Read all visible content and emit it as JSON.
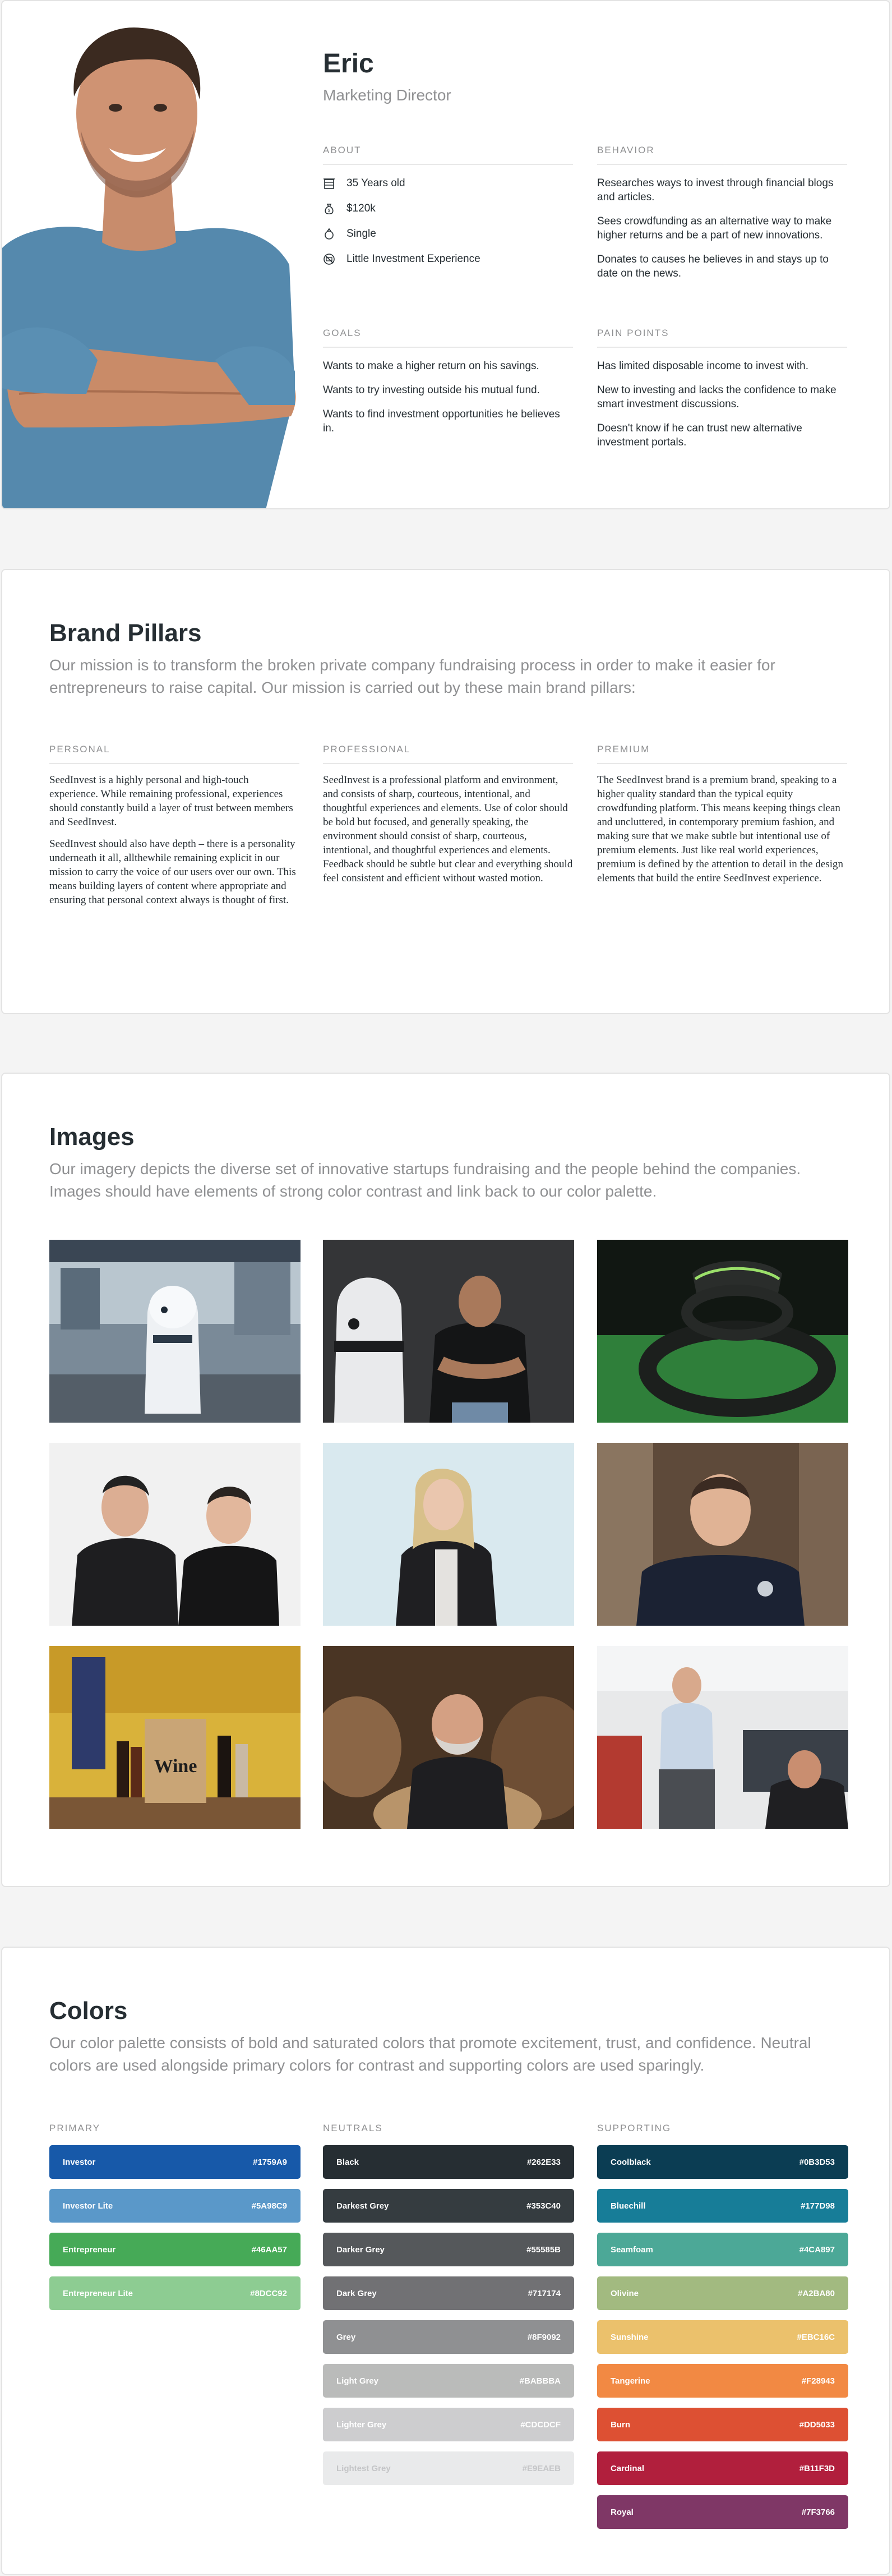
{
  "persona": {
    "name": "Eric",
    "role": "Marketing Director",
    "about_heading": "ABOUT",
    "about": [
      {
        "icon": "building-icon",
        "text": "35 Years old"
      },
      {
        "icon": "money-bag-icon",
        "text": "$120k"
      },
      {
        "icon": "ring-icon",
        "text": "Single"
      },
      {
        "icon": "no-cash-icon",
        "text": "Little Investment Experience"
      }
    ],
    "behavior_heading": "BEHAVIOR",
    "behavior": [
      "Researches ways to invest through financial blogs and articles.",
      "Sees crowdfunding as an alternative way to make higher returns and be a part of new innovations.",
      "Donates to causes he believes in and stays up to date on the news."
    ],
    "goals_heading": "GOALS",
    "goals": [
      "Wants to make a higher return on his savings.",
      "Wants to try investing outside his mutual fund.",
      "Wants to find investment opportunities he believes in."
    ],
    "pain_heading": "PAIN POINTS",
    "pain_points": [
      "Has limited disposable income to invest with.",
      "New to investing and lacks the confidence to make smart investment discussions.",
      "Doesn't know if he can trust new alternative investment portals."
    ]
  },
  "pillars": {
    "title": "Brand Pillars",
    "subtitle": "Our mission is to transform the broken private company fundraising process in order to make it easier for entrepreneurs to raise capital. Our mission is carried out by these main brand pillars:",
    "items": [
      {
        "heading": "PERSONAL",
        "paragraphs": [
          "SeedInvest is a highly personal and high-touch experience. While remaining professional, experiences should constantly build a layer of trust between members and SeedInvest.",
          "SeedInvest should also have depth – there is a personality underneath it all, allthewhile remaining explicit in our mission to carry the voice of our users over our own. This means building layers of content where appropriate and ensuring that personal context always is thought of first."
        ]
      },
      {
        "heading": "PROFESSIONAL",
        "paragraphs": [
          "SeedInvest is a professional platform and environment, and consists of sharp, courteous, intentional, and thoughtful experiences and elements. Use of color should be bold but focused, and generally speaking, the environment should consist of sharp, courteous, intentional, and thoughtful experiences and elements. Feedback should be subtle but clear and everything should feel consistent and efficient without wasted motion."
        ]
      },
      {
        "heading": "PREMIUM",
        "paragraphs": [
          "The SeedInvest brand is a premium brand, speaking to a higher quality standard than the typical equity crowdfunding platform. This means keeping things clean and uncluttered, in contemporary premium fashion, and making sure that we make subtle but intentional use of premium elements. Just like real world experiences, premium is defined by the attention to detail in the design elements that build the entire SeedInvest experience."
        ]
      }
    ]
  },
  "images": {
    "title": "Images",
    "subtitle": "Our imagery depicts the diverse set of innovative startups fundraising and the people behind the companies. Images should have elements of strong color contrast and link back to our color palette.",
    "wine_label": "Wine"
  },
  "colors": {
    "title": "Colors",
    "subtitle": "Our color palette consists of bold and saturated colors that promote excitement, trust, and confidence. Neutral colors are used alongside primary colors for contrast and supporting colors are used sparingly.",
    "primary_heading": "PRIMARY",
    "primary": [
      {
        "name": "Investor",
        "hex": "#1759A9",
        "text_color": "#ffffff"
      },
      {
        "name": "Investor Lite",
        "hex": "#5A98C9",
        "text_color": "#ffffff"
      },
      {
        "name": "Entrepreneur",
        "hex": "#46AA57",
        "text_color": "#ffffff"
      },
      {
        "name": "Entrepreneur Lite",
        "hex": "#8DCC92",
        "text_color": "#ffffff"
      }
    ],
    "neutrals_heading": "NEUTRALS",
    "neutrals": [
      {
        "name": "Black",
        "hex": "#262E33",
        "text_color": "#ffffff"
      },
      {
        "name": "Darkest Grey",
        "hex": "#353C40",
        "text_color": "#ffffff"
      },
      {
        "name": "Darker Grey",
        "hex": "#55585B",
        "text_color": "#ffffff"
      },
      {
        "name": "Dark Grey",
        "hex": "#717174",
        "text_color": "#ffffff"
      },
      {
        "name": "Grey",
        "hex": "#8F9092",
        "text_color": "#ffffff"
      },
      {
        "name": "Light Grey",
        "hex": "#BABBBA",
        "text_color": "#ffffff"
      },
      {
        "name": "Lighter Grey",
        "hex": "#CDCDCF",
        "text_color": "#ffffff"
      },
      {
        "name": "Lightest Grey",
        "hex": "#E9EAEB",
        "text_color": "#c4c5c7"
      }
    ],
    "supporting_heading": "SUPPORTING",
    "supporting": [
      {
        "name": "Coolblack",
        "hex": "#0B3D53",
        "text_color": "#ffffff"
      },
      {
        "name": "Bluechill",
        "hex": "#177D98",
        "text_color": "#ffffff"
      },
      {
        "name": "Seamfoam",
        "hex": "#4CA897",
        "text_color": "#ffffff"
      },
      {
        "name": "Olivine",
        "hex": "#A2BA80",
        "text_color": "#ffffff"
      },
      {
        "name": "Sunshine",
        "hex": "#EBC16C",
        "text_color": "#ffffff"
      },
      {
        "name": "Tangerine",
        "hex": "#F28943",
        "text_color": "#ffffff"
      },
      {
        "name": "Burn",
        "hex": "#DD5033",
        "text_color": "#ffffff"
      },
      {
        "name": "Cardinal",
        "hex": "#B11F3D",
        "text_color": "#ffffff"
      },
      {
        "name": "Royal",
        "hex": "#7F3766",
        "text_color": "#ffffff"
      }
    ]
  }
}
